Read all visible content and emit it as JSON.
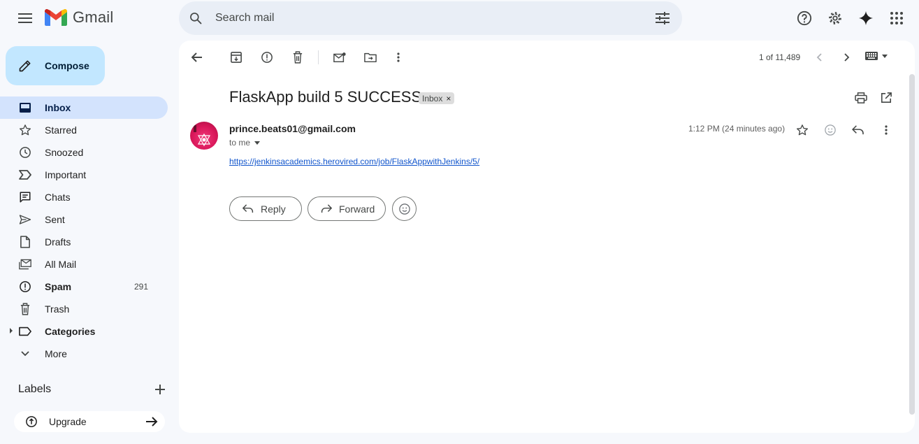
{
  "app": {
    "name": "Gmail"
  },
  "search": {
    "placeholder": "Search mail"
  },
  "compose": {
    "label": "Compose"
  },
  "sidebar": {
    "items": [
      {
        "label": "Inbox",
        "icon": "inbox-icon",
        "count": ""
      },
      {
        "label": "Starred",
        "icon": "star-icon",
        "count": ""
      },
      {
        "label": "Snoozed",
        "icon": "clock-icon",
        "count": ""
      },
      {
        "label": "Important",
        "icon": "important-icon",
        "count": ""
      },
      {
        "label": "Chats",
        "icon": "chat-icon",
        "count": ""
      },
      {
        "label": "Sent",
        "icon": "send-icon",
        "count": ""
      },
      {
        "label": "Drafts",
        "icon": "draft-icon",
        "count": ""
      },
      {
        "label": "All Mail",
        "icon": "all-mail-icon",
        "count": ""
      },
      {
        "label": "Spam",
        "icon": "spam-icon",
        "count": "291"
      },
      {
        "label": "Trash",
        "icon": "trash-icon",
        "count": ""
      },
      {
        "label": "Categories",
        "icon": "label-icon",
        "count": ""
      },
      {
        "label": "More",
        "icon": "chevron-down-icon",
        "count": ""
      }
    ],
    "labels_title": "Labels",
    "upgrade_label": "Upgrade"
  },
  "toolbar": {
    "pager": "1 of 11,489"
  },
  "email": {
    "subject": "FlaskApp build 5 SUCCESS",
    "label_chip": "Inbox",
    "chip_close": "×",
    "sender": "prince.beats01@gmail.com",
    "to": "to me",
    "time": "1:12 PM (24 minutes ago)",
    "body_link": "https://jenkinsacademics.herovired.com/job/FlaskAppwithJenkins/5/"
  },
  "actions": {
    "reply": "Reply",
    "forward": "Forward"
  },
  "colors": {
    "accent": "#c2e7ff",
    "active_nav": "#d3e3fd",
    "link": "#1155cc",
    "background": "#f6f8fc"
  }
}
